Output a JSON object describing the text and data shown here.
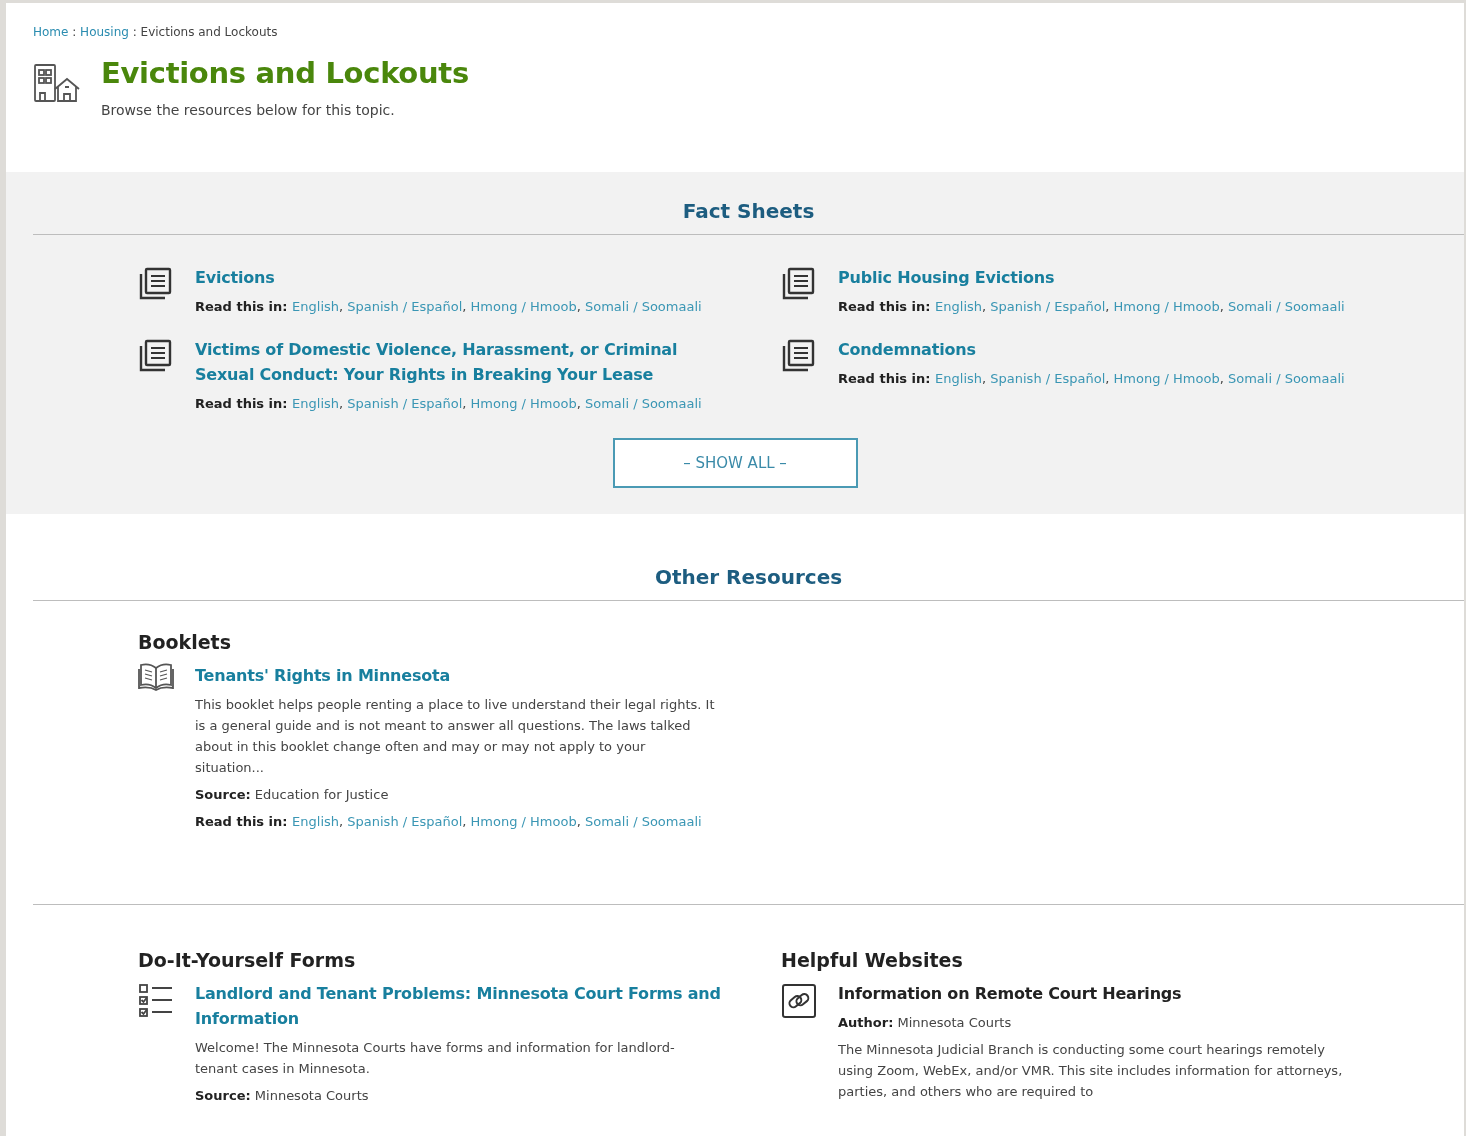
{
  "breadcrumb": {
    "separator": ":",
    "items": [
      {
        "text": "Home",
        "link": true
      },
      {
        "text": "Housing",
        "link": true
      },
      {
        "text": "Evictions and Lockouts",
        "link": false
      }
    ]
  },
  "language_separator": ",",
  "title": "Evictions and Lockouts",
  "subtitle": "Browse the resources below for this topic.",
  "fact_sheets": {
    "heading": "Fact Sheets",
    "items": [
      {
        "kind": "document",
        "title": "Evictions",
        "linked": true,
        "read_label": "Read this in:",
        "languages": [
          "English",
          "Spanish / Español",
          "Hmong / Hmoob",
          "Somali / Soomaali"
        ]
      },
      {
        "kind": "document",
        "title": "Public Housing Evictions",
        "linked": true,
        "read_label": "Read this in:",
        "languages": [
          "English",
          "Spanish / Español",
          "Hmong / Hmoob",
          "Somali / Soomaali"
        ]
      },
      {
        "kind": "document",
        "title": "Victims of Domestic Violence, Harassment, or Criminal Sexual Conduct: Your Rights in Breaking Your Lease",
        "linked": true,
        "read_label": "Read this in:",
        "languages": [
          "English",
          "Spanish / Español",
          "Hmong / Hmoob",
          "Somali / Soomaali"
        ]
      },
      {
        "kind": "document",
        "title": "Condemnations",
        "linked": true,
        "read_label": "Read this in:",
        "languages": [
          "English",
          "Spanish / Español",
          "Hmong / Hmoob",
          "Somali / Soomaali"
        ]
      }
    ],
    "show_all": "– SHOW ALL –"
  },
  "other_resources": {
    "heading": "Other Resources",
    "rows": [
      [
        {
          "heading": "Booklets",
          "items": [
            {
              "kind": "book",
              "title": "Tenants' Rights in Minnesota",
              "linked": true,
              "description": "This booklet helps people renting a place to live understand their legal rights. It is a general guide and is not meant to answer all questions. The laws talked about in this booklet change often and may or may not apply to your situation...",
              "meta": [
                "**Source:** Education for Justice"
              ],
              "read_label": "Read this in:",
              "languages": [
                "English",
                "Spanish / Español",
                "Hmong / Hmoob",
                "Somali / Soomaali"
              ]
            }
          ]
        }
      ],
      [
        {
          "heading": "Do-It-Yourself Forms",
          "items": [
            {
              "kind": "checklist",
              "title": "Landlord and Tenant Problems: Minnesota Court Forms and Information",
              "linked": true,
              "description": "Welcome! The Minnesota Courts have forms and information for landlord-tenant cases in Minnesota.",
              "meta": [
                "**Source:** Minnesota Courts"
              ]
            }
          ]
        },
        {
          "heading": "Helpful Websites",
          "items": [
            {
              "kind": "link",
              "title": "Information on Remote Court Hearings",
              "linked": false,
              "meta": [
                "**Author:** Minnesota Courts"
              ],
              "description": "The Minnesota Judicial Branch is conducting some court hearings remotely using Zoom, WebEx, and/or VMR. This site includes information for attorneys, parties, and others who are required to"
            }
          ]
        }
      ]
    ]
  }
}
